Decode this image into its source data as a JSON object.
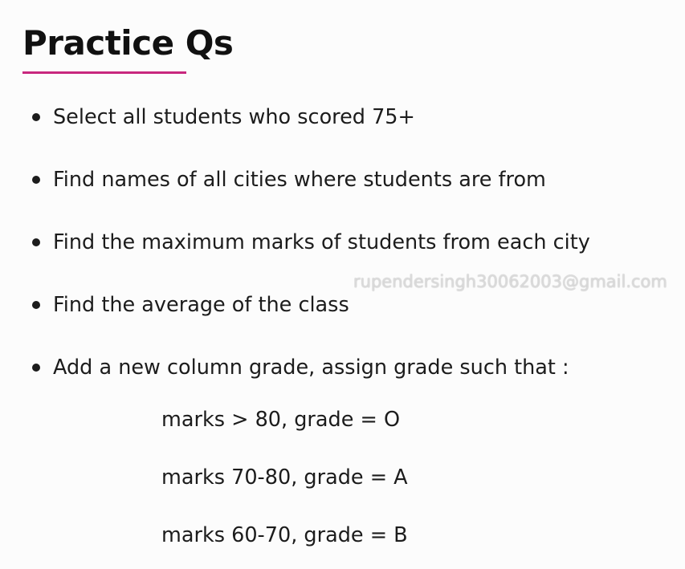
{
  "slide": {
    "title": "Practice Qs",
    "accent_color": "#c8287e",
    "bullets": [
      "Select all students who scored 75+",
      "Find names of all cities where students are from",
      "Find the maximum marks of students from each city",
      "Find the average of the class",
      "Add a new column grade, assign grade such that :"
    ],
    "grade_rules": [
      "marks > 80, grade = O",
      "marks 70-80, grade = A",
      "marks 60-70, grade = B"
    ],
    "watermark": "rupendersingh30062003@gmail.com"
  }
}
